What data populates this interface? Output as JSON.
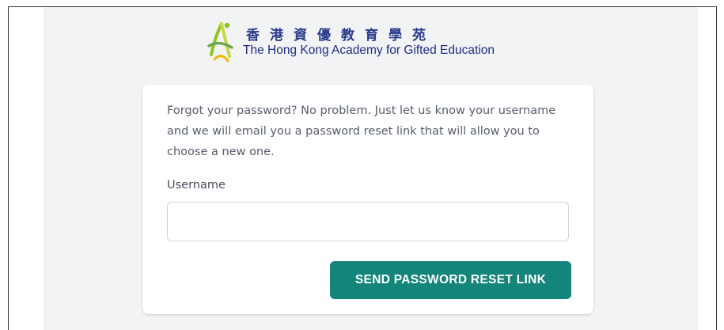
{
  "logo": {
    "chinese_name": "香港資優教育學苑",
    "english_name": "The Hong Kong Academy for Gifted Education"
  },
  "form": {
    "intro_text": "Forgot your password? No problem. Just let us know your username and we will email you a password reset link that will allow you to choose a new one.",
    "username_label": "Username",
    "username_value": "",
    "submit_label": "SEND PASSWORD RESET LINK"
  },
  "colors": {
    "primary_button": "#14857a",
    "page_background": "#f2f3f5",
    "logo_text": "#1e2d80"
  }
}
